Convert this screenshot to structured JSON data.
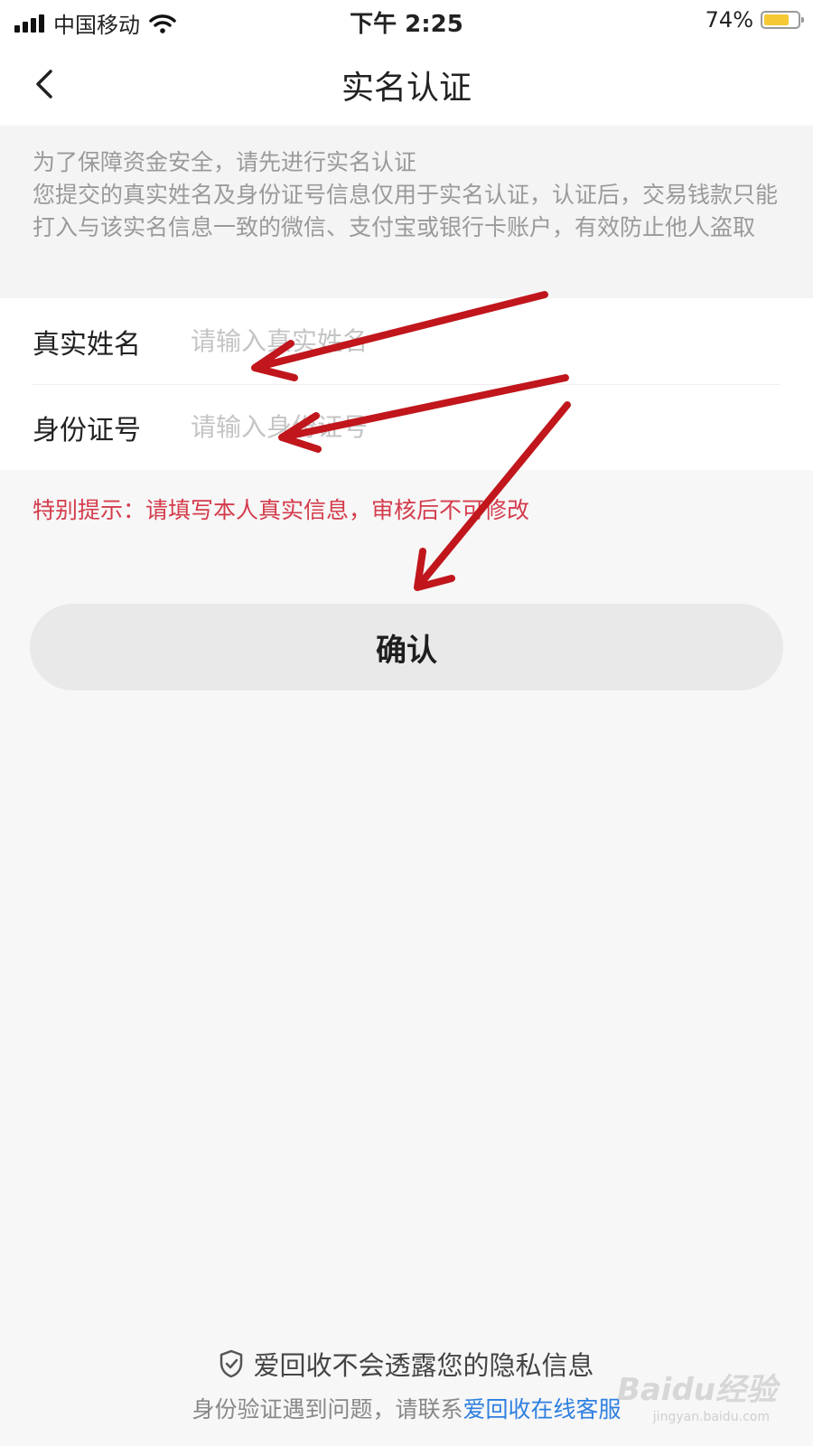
{
  "status_bar": {
    "carrier": "中国移动",
    "time": "下午 2:25",
    "battery_percent": "74%",
    "battery_level": 0.74,
    "battery_color": "#f6c932",
    "icons": [
      "signal-icon",
      "wifi-icon",
      "battery-icon"
    ]
  },
  "nav": {
    "title": "实名认证",
    "back_icon": "chevron-left-icon"
  },
  "notice": {
    "line1": "为了保障资金安全，请先进行实名认证",
    "line2": "您提交的真实姓名及身份证号信息仅用于实名认证，认证后，交易钱款只能打入与该实名信息一致的微信、支付宝或银行卡账户，有效防止他人盗取"
  },
  "form": {
    "name_label": "真实姓名",
    "name_placeholder": "请输入真实姓名",
    "name_value": "",
    "id_label": "身份证号",
    "id_placeholder": "请输入身份证号",
    "id_value": ""
  },
  "warning": "特别提示：请填写本人真实信息，审核后不可修改",
  "confirm_label": "确认",
  "footer": {
    "privacy_text": "爱回收不会透露您的隐私信息",
    "privacy_icon": "shield-check-icon",
    "help_text": "身份验证遇到问题，请联系",
    "help_link": "爱回收在线客服"
  },
  "watermark": {
    "text": "Baidu经验",
    "sub": "jingyan.baidu.com"
  },
  "colors": {
    "warning": "#d43c4c",
    "link": "#2e7fe0",
    "annotation_arrow": "#c0161c",
    "button_bg": "#e9e9e9"
  }
}
